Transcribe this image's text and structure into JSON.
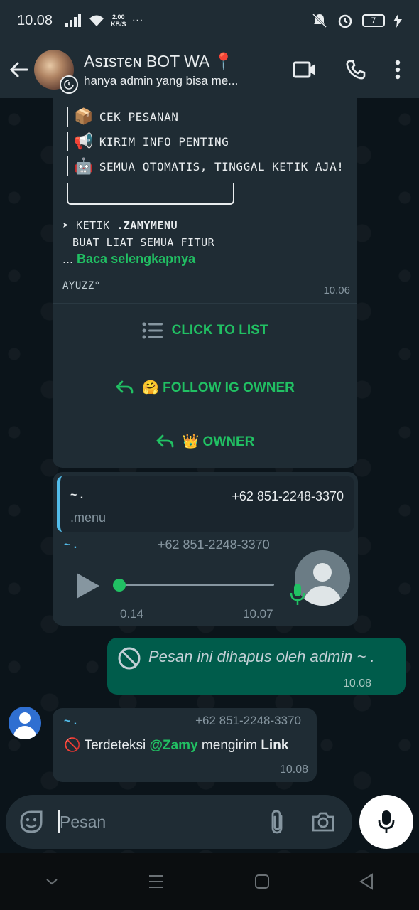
{
  "status_bar": {
    "time": "10.08",
    "net_speed_value": "2.00",
    "net_speed_unit": "KB/S",
    "more": "···",
    "battery": "7"
  },
  "header": {
    "title": "Asɪsтєɴ BOT WA 📍",
    "subtitle": "hanya admin yang bisa me..."
  },
  "bot_message": {
    "menu_items": [
      {
        "icon": "📦",
        "label": "CEK PESANAN"
      },
      {
        "icon": "📢",
        "label": "KIRIM INFO PENTING"
      },
      {
        "icon": "🤖",
        "label": "SEMUA OTOMATIS, TINGGAL KETIK AJA!"
      }
    ],
    "ketik_prefix": "➤ KETIK ",
    "ketik_cmd": ".ZAMYMENU",
    "buat_liat": "BUAT LIAT SEMUA FITUR",
    "ellipsis": "...",
    "read_more": "Baca selengkapnya",
    "footer": "AYUZZ°",
    "time": "10.06",
    "buttons": [
      {
        "label": "CLICK TO LIST",
        "icon": "list-icon"
      },
      {
        "label": "🤗 FOLLOW IG OWNER",
        "icon": "reply-icon"
      },
      {
        "label": "👑 OWNER",
        "icon": "reply-icon"
      }
    ]
  },
  "audio_message": {
    "quote_sender": "~ .",
    "quote_phone": "+62 851-2248-3370",
    "quote_text": ".menu",
    "sender": "~ .",
    "phone": "+62 851-2248-3370",
    "duration": "0.14",
    "progress": 0,
    "time": "10.07"
  },
  "deleted_message": {
    "text": "Pesan ini dihapus oleh admin ~ .",
    "time": "10.08"
  },
  "last_message": {
    "sender": "~ .",
    "phone": "+62 851-2248-3370",
    "prefix": "🚫 Terdeteksi ",
    "mention": "@Zamy",
    "middle": " mengirim ",
    "bold": "Link",
    "time": "10.08"
  },
  "composer": {
    "placeholder": "Pesan"
  },
  "colors": {
    "accent": "#21c063",
    "bubble_in": "#1f2c34",
    "bubble_out": "#005c4b",
    "header": "#1f2c34",
    "quote_bar": "#53bdeb"
  }
}
